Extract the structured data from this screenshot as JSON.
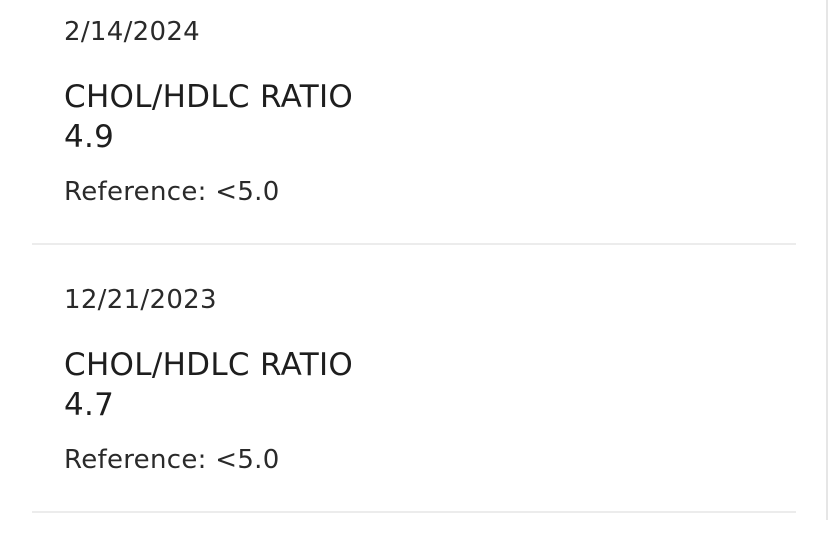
{
  "results": [
    {
      "date": "2/14/2024",
      "test_name": "CHOL/HDLC RATIO",
      "value": "4.9",
      "reference": "Reference: <5.0"
    },
    {
      "date": "12/21/2023",
      "test_name": "CHOL/HDLC RATIO",
      "value": "4.7",
      "reference": "Reference: <5.0"
    }
  ]
}
